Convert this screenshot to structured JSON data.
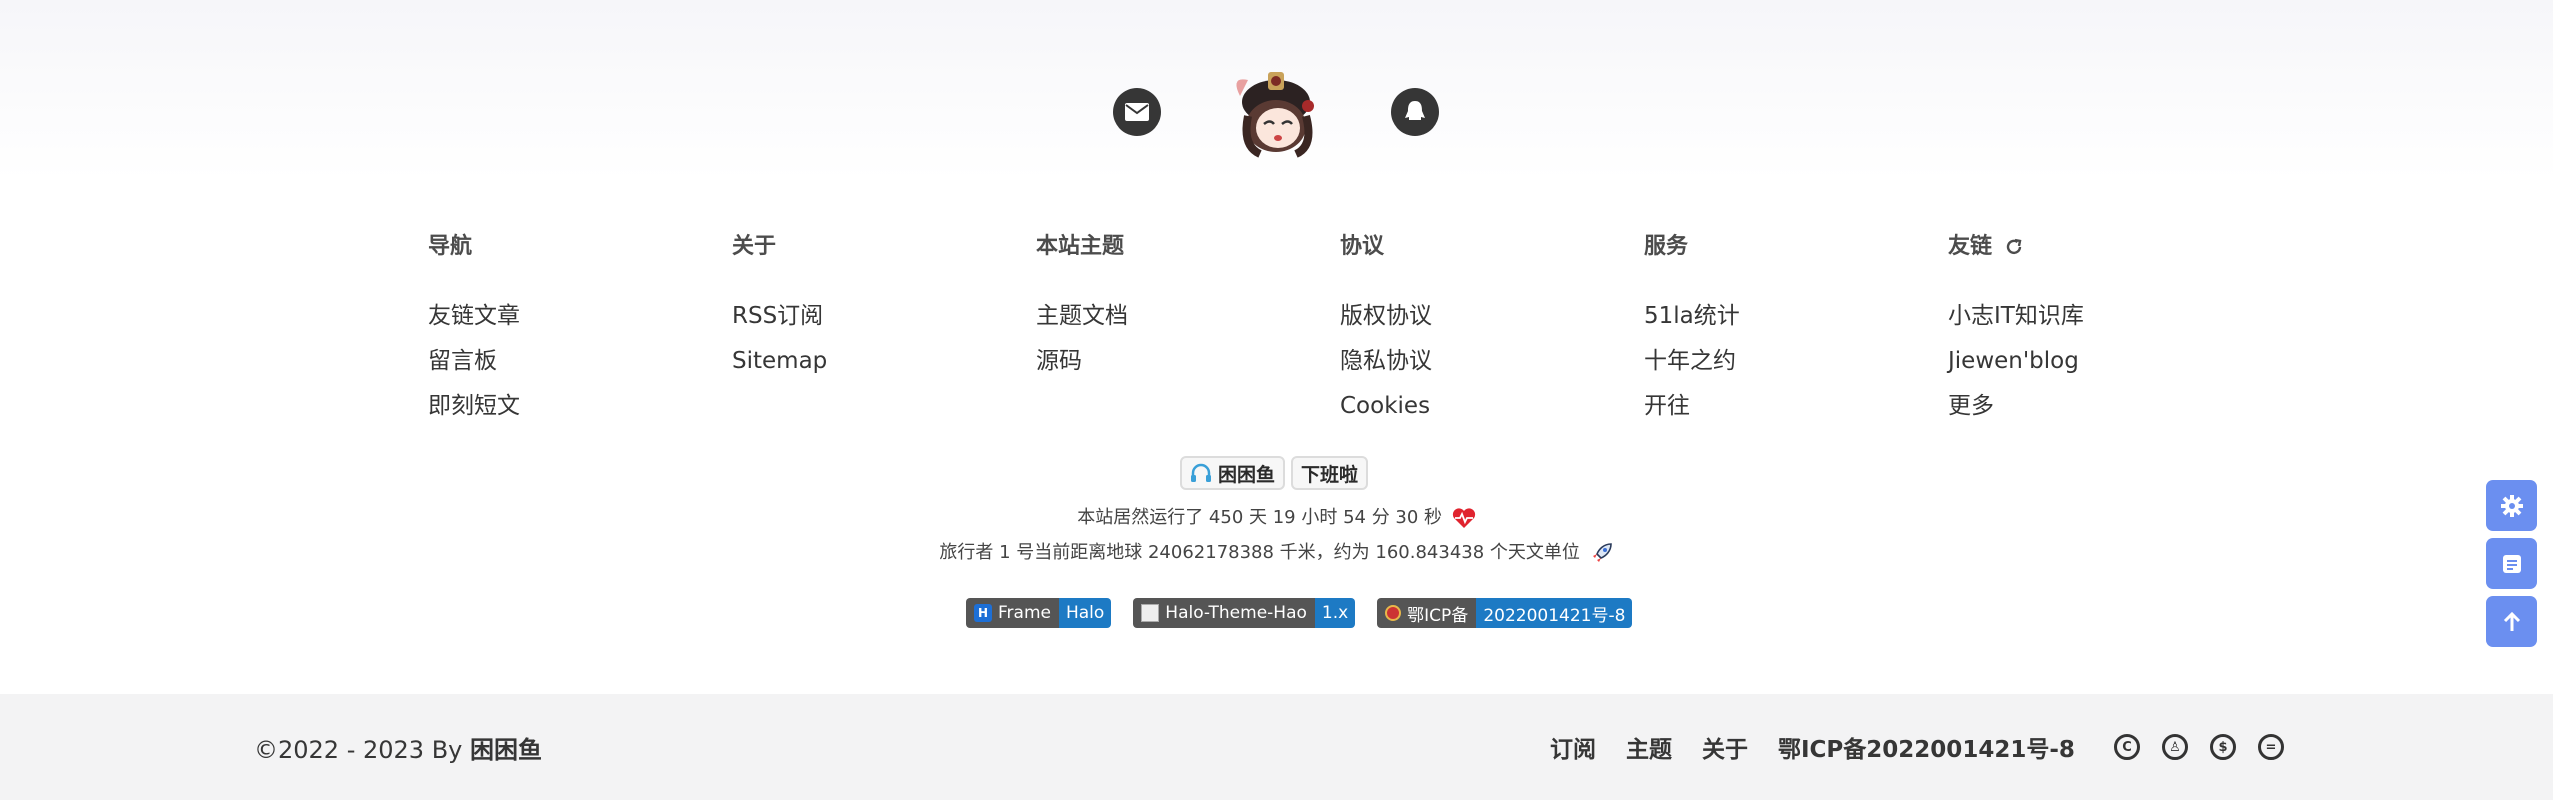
{
  "columns": [
    {
      "title": "导航",
      "items": [
        "友链文章",
        "留言板",
        "即刻短文"
      ]
    },
    {
      "title": "关于",
      "items": [
        "RSS订阅",
        "Sitemap"
      ]
    },
    {
      "title": "本站主题",
      "items": [
        "主题文档",
        "源码"
      ]
    },
    {
      "title": "协议",
      "items": [
        "版权协议",
        "隐私协议",
        "Cookies"
      ]
    },
    {
      "title": "服务",
      "items": [
        "51la统计",
        "十年之约",
        "开往"
      ]
    },
    {
      "title": "友链",
      "items": [
        "小志IT知识库",
        "Jiewen'blog",
        "更多"
      ],
      "icon": "refresh-icon"
    }
  ],
  "status": {
    "name": "困困鱼",
    "state": "下班啦"
  },
  "runtime": "本站居然运行了 450 天 19 小时 54 分 30 秒",
  "travel": "旅行者 1 号当前距离地球 24062178388 千米，约为 160.843438 个天文单位",
  "shields": [
    {
      "label": "Frame",
      "value": "Halo"
    },
    {
      "label": "Halo-Theme-Hao",
      "value": "1.x"
    },
    {
      "label": "鄂ICP备",
      "value": "2022001421号-8"
    }
  ],
  "footer": {
    "copyright": "©2022 - 2023  By",
    "author": "困困鱼",
    "links": [
      "订阅",
      "主题",
      "关于",
      "鄂ICP备2022001421号-8"
    ]
  },
  "colors": {
    "accent": "#6b8ff0",
    "shield_blue": "#1d7ac4",
    "heart": "#e0232e"
  }
}
